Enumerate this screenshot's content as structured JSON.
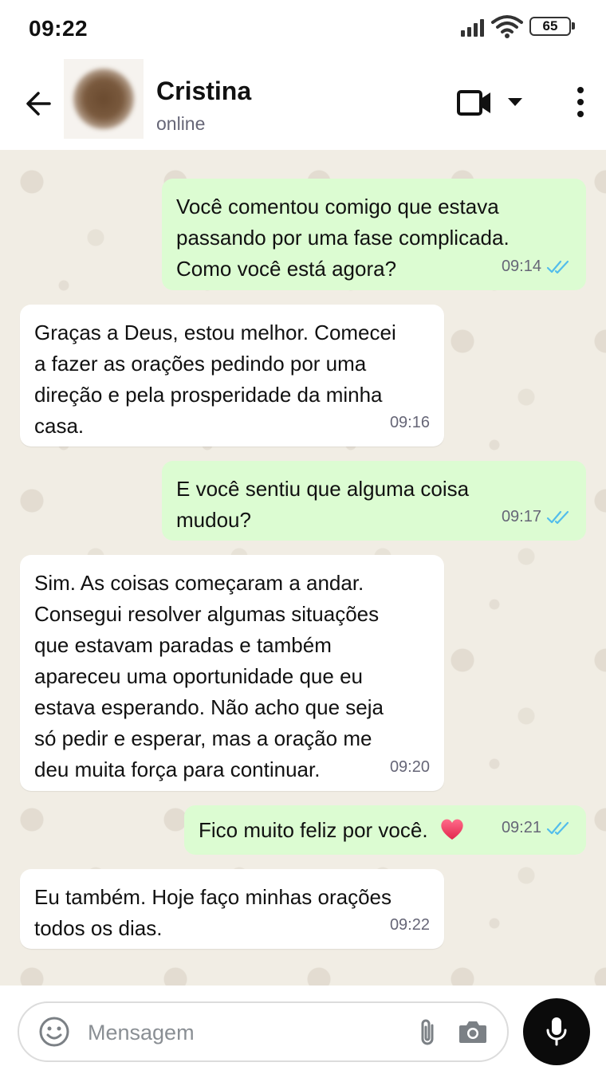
{
  "status_bar": {
    "time": "09:22",
    "battery": "65"
  },
  "header": {
    "contact_name": "Cristina",
    "presence": "online"
  },
  "messages": [
    {
      "direction": "out",
      "text": "Você comentou comigo que estava\npassando por uma fase complicada.\nComo você está agora?",
      "time": "09:14",
      "read": true
    },
    {
      "direction": "in",
      "text": "Graças a Deus, estou melhor. Comecei\na fazer as orações pedindo por uma\ndireção e pela prosperidade da minha\ncasa.",
      "time": "09:16"
    },
    {
      "direction": "out",
      "text": "E você sentiu que alguma coisa\nmudou?",
      "time": "09:17",
      "read": true
    },
    {
      "direction": "in",
      "text": "Sim. As coisas começaram a andar.\nConsegui resolver algumas situações\nque estavam paradas e também\napareceu uma oportunidade que eu\nestava esperando. Não acho que seja\nsó pedir e esperar, mas a oração me\ndeu muita força para continuar.",
      "time": "09:20"
    },
    {
      "direction": "out",
      "text": "Fico muito feliz por você.",
      "emoji": "heart",
      "time": "09:21",
      "read": true
    },
    {
      "direction": "in",
      "text": "Eu também. Hoje faço minhas orações\ntodos os dias.",
      "time": "09:22"
    }
  ],
  "composer": {
    "placeholder": "Mensagem"
  },
  "icons": {
    "back": "arrow-left-icon",
    "video": "video-camera-icon",
    "dropdown": "caret-down-icon",
    "more": "more-vertical-icon",
    "emoji": "emoji-icon",
    "attach": "paperclip-icon",
    "camera": "camera-icon",
    "mic": "microphone-icon",
    "read": "double-check-icon"
  },
  "colors": {
    "outgoing_bubble": "#dcfcd2",
    "incoming_bubble": "#ffffff",
    "read_ticks": "#53bdeb",
    "chat_bg": "#f1ede4",
    "mic_button": "#0b0b0b"
  }
}
